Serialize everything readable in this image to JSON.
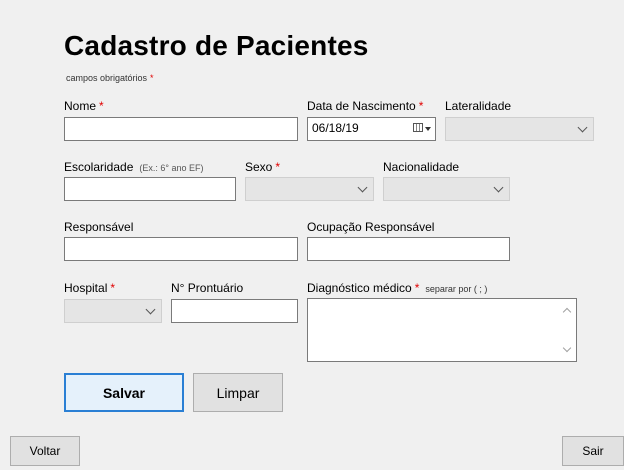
{
  "header": {
    "title": "Cadastro de Pacientes",
    "required_note": "campos obrigatórios",
    "required_mark": "*"
  },
  "fields": {
    "nome": {
      "label": "Nome",
      "required": "*",
      "value": ""
    },
    "data_nascimento": {
      "label": "Data de Nascimento",
      "required": "*",
      "value": "06/18/19"
    },
    "lateralidade": {
      "label": "Lateralidade",
      "selected": ""
    },
    "escolaridade": {
      "label": "Escolaridade",
      "hint": "(Ex.: 6° ano EF)",
      "value": ""
    },
    "sexo": {
      "label": "Sexo",
      "required": "*",
      "selected": ""
    },
    "nacionalidade": {
      "label": "Nacionalidade",
      "selected": ""
    },
    "responsavel": {
      "label": "Responsável",
      "value": ""
    },
    "ocupacao_responsavel": {
      "label": "Ocupação Responsável",
      "value": ""
    },
    "hospital": {
      "label": "Hospital",
      "required": "*",
      "selected": ""
    },
    "prontuario": {
      "label": "N° Prontuário",
      "value": ""
    },
    "diagnostico": {
      "label": "Diagnóstico médico",
      "required": "*",
      "hint": "separar por ( ; )",
      "value": ""
    }
  },
  "buttons": {
    "salvar": "Salvar",
    "limpar": "Limpar",
    "voltar": "Voltar",
    "sair": "Sair"
  },
  "colors": {
    "required": "#e00000",
    "primary_border": "#2a7fd4",
    "background": "#f0f0f0"
  }
}
